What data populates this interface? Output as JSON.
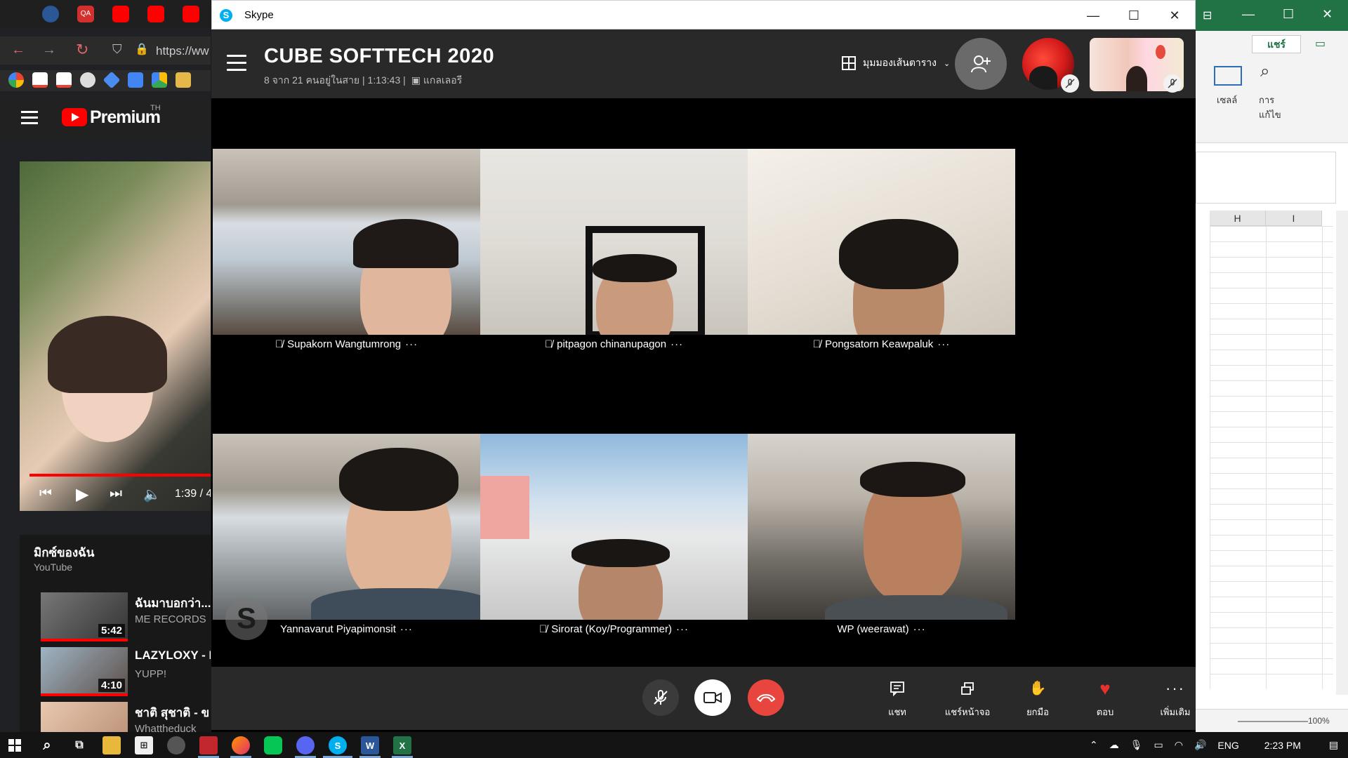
{
  "browser": {
    "address_text": "https://ww",
    "yt_logo_text": "Premium",
    "yt_region": "TH",
    "player_time": "1:39 / 4",
    "mix_title": "มิกซ์ของฉัน",
    "mix_subtitle": "YouTube",
    "mix_items": [
      {
        "title": "ฉันมาบอกว่า...",
        "channel": "ME RECORDS",
        "duration": "5:42"
      },
      {
        "title": "LAZYLOXY - I",
        "channel": "YUPP!",
        "duration": "4:10"
      },
      {
        "title": "ชาติ สุชาติ - ข",
        "channel": "Whattheduck",
        "duration": ""
      }
    ]
  },
  "excel": {
    "share_label": "แชร์",
    "cells_label": "เซลล์",
    "edit_label": "การ แก้ไข",
    "columns": [
      "H",
      "I"
    ],
    "zoom": "100%"
  },
  "skype": {
    "window_title": "Skype",
    "call_title": "CUBE SOFTTECH 2020",
    "call_subtitle": "8 จาก 21 คนอยู่ในสาย | 1:13:43 |",
    "gallery_label": "แกลเลอรี",
    "view_mode": "มุมมองเส้นตาราง",
    "participants": [
      {
        "name": "Supakorn Wangtumrong",
        "muted": true
      },
      {
        "name": "pitpagon chinanupagon",
        "muted": true
      },
      {
        "name": "Pongsatorn Keawpaluk",
        "muted": true
      },
      {
        "name": "Yannavarut Piyapimonsit",
        "muted": false
      },
      {
        "name": "Sirorat (Koy/Programmer)",
        "muted": true
      },
      {
        "name": "WP (weerawat)",
        "muted": false
      }
    ],
    "controls": {
      "chat": "แชท",
      "share_screen": "แชร์หน้าจอ",
      "raise_hand": "ยกมือ",
      "react": "ตอบ",
      "more": "เพิ่มเติม"
    },
    "colors": {
      "end_call": "#e9453f",
      "react_heart": "#e9302f"
    }
  },
  "taskbar": {
    "language": "ENG",
    "time": "2:23 PM"
  }
}
